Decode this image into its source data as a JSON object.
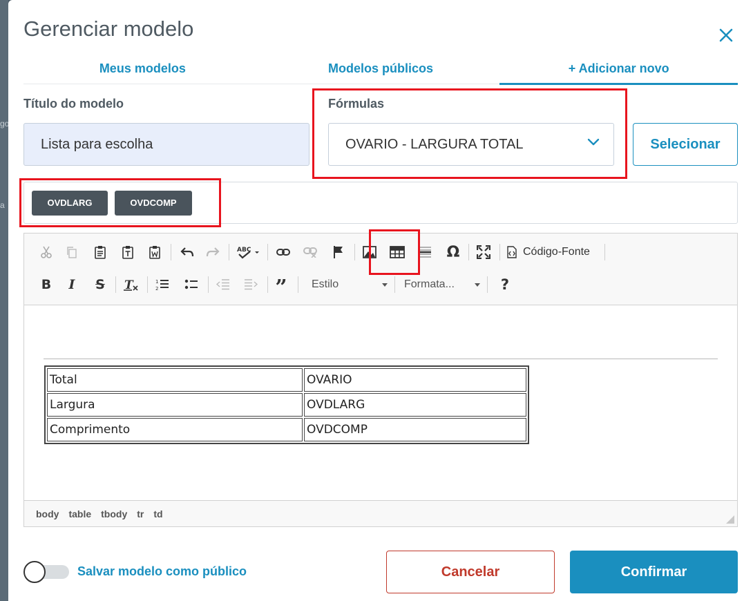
{
  "backdrop": {
    "fragments": [
      "go",
      "a"
    ]
  },
  "modal": {
    "title": "Gerenciar modelo",
    "close_icon": "close-icon"
  },
  "tabs": [
    {
      "label": "Meus modelos",
      "active": false
    },
    {
      "label": "Modelos públicos",
      "active": false
    },
    {
      "label": "+ Adicionar novo",
      "active": true
    }
  ],
  "form": {
    "title_label": "Título do modelo",
    "title_value": "Lista para escolha",
    "formulas_label": "Fórmulas",
    "formula_selected": "OVARIO - LARGURA TOTAL",
    "select_button": "Selecionar"
  },
  "chips": [
    "OVDLARG",
    "OVDCOMP"
  ],
  "toolbar": {
    "source_label": "Código-Fonte",
    "style_combo": "Estilo",
    "format_combo": "Formata...",
    "help_label": "?",
    "icons": [
      "cut-icon",
      "copy-icon",
      "paste-icon",
      "paste-text-icon",
      "paste-word-icon",
      "undo-icon",
      "redo-icon",
      "spellcheck-icon",
      "link-icon",
      "unlink-icon",
      "anchor-flag-icon",
      "image-icon",
      "table-icon",
      "horizontal-line-icon",
      "special-char-icon",
      "maximize-icon",
      "source-icon",
      "bold-icon",
      "italic-icon",
      "strike-icon",
      "remove-format-icon",
      "numbered-list-icon",
      "bullet-list-icon",
      "outdent-icon",
      "indent-icon",
      "blockquote-icon",
      "help-icon"
    ]
  },
  "document": {
    "rows": [
      [
        "Total",
        "OVARIO"
      ],
      [
        "Largura",
        "OVDLARG"
      ],
      [
        "Comprimento",
        "OVDCOMP"
      ]
    ]
  },
  "path": [
    "body",
    "table",
    "tbody",
    "tr",
    "td"
  ],
  "footer": {
    "toggle_label": "Salvar modelo como público",
    "toggle_on": false,
    "cancel": "Cancelar",
    "confirm": "Confirmar"
  },
  "colors": {
    "accent": "#1a8fbf",
    "danger": "#c0392b",
    "highlight_box": "#e8141e",
    "chip_bg": "#4a545c"
  }
}
